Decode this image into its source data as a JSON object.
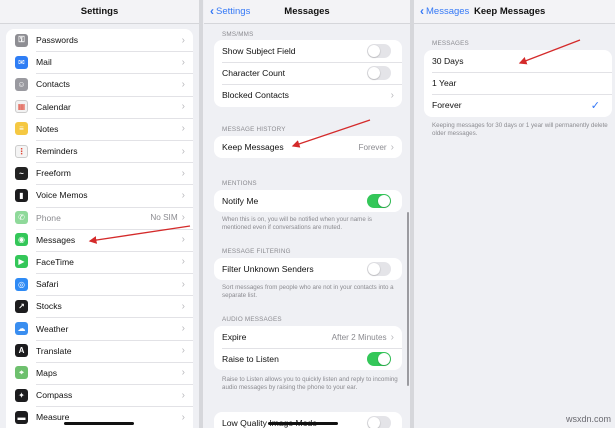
{
  "settings_pane": {
    "title": "Settings",
    "items": [
      {
        "label": "Passwords",
        "icon": "key-icon",
        "color": "#8e8e93",
        "glyph": "⚿"
      },
      {
        "label": "Mail",
        "icon": "mail-icon",
        "color": "#2f7ef5",
        "glyph": "✉"
      },
      {
        "label": "Contacts",
        "icon": "contacts-icon",
        "color": "#9a9aa0",
        "glyph": "☺"
      },
      {
        "label": "Calendar",
        "icon": "calendar-icon",
        "color": "#f2f2f2",
        "glyph": "▦"
      },
      {
        "label": "Notes",
        "icon": "notes-icon",
        "color": "#f5c842",
        "glyph": "≡"
      },
      {
        "label": "Reminders",
        "icon": "reminders-icon",
        "color": "#f4f4f4",
        "glyph": "⋮"
      },
      {
        "label": "Freeform",
        "icon": "freeform-icon",
        "color": "#222222",
        "glyph": "~"
      },
      {
        "label": "Voice Memos",
        "icon": "voice-memos-icon",
        "color": "#1c1c1e",
        "glyph": "▮"
      },
      {
        "label": "Phone",
        "icon": "phone-icon",
        "color": "#8fd99a",
        "glyph": "✆",
        "value": "No SIM",
        "dimmed": true
      },
      {
        "label": "Messages",
        "icon": "messages-icon",
        "color": "#34c759",
        "glyph": "◉"
      },
      {
        "label": "FaceTime",
        "icon": "facetime-icon",
        "color": "#34c759",
        "glyph": "▶"
      },
      {
        "label": "Safari",
        "icon": "safari-icon",
        "color": "#2f8bf5",
        "glyph": "◎"
      },
      {
        "label": "Stocks",
        "icon": "stocks-icon",
        "color": "#1c1c1e",
        "glyph": "↗"
      },
      {
        "label": "Weather",
        "icon": "weather-icon",
        "color": "#3a8ef0",
        "glyph": "☁"
      },
      {
        "label": "Translate",
        "icon": "translate-icon",
        "color": "#1c1c1e",
        "glyph": "A"
      },
      {
        "label": "Maps",
        "icon": "maps-icon",
        "color": "#6ec06e",
        "glyph": "⌖"
      },
      {
        "label": "Compass",
        "icon": "compass-icon",
        "color": "#1c1c1e",
        "glyph": "✦"
      },
      {
        "label": "Measure",
        "icon": "measure-icon",
        "color": "#1c1c1e",
        "glyph": "▬"
      }
    ]
  },
  "messages_pane": {
    "back_label": "Settings",
    "title": "Messages",
    "sms_header": "SMS/MMS",
    "show_subject": "Show Subject Field",
    "character_count": "Character Count",
    "blocked_contacts": "Blocked Contacts",
    "history_header": "MESSAGE HISTORY",
    "keep_messages": "Keep Messages",
    "keep_messages_value": "Forever",
    "mentions_header": "MENTIONS",
    "notify_me": "Notify Me",
    "notify_footnote": "When this is on, you will be notified when your name is mentioned even if conversations are muted.",
    "filtering_header": "MESSAGE FILTERING",
    "filter_unknown": "Filter Unknown Senders",
    "filter_footnote": "Sort messages from people who are not in your contacts into a separate list.",
    "audio_header": "AUDIO MESSAGES",
    "expire": "Expire",
    "expire_value": "After 2 Minutes",
    "raise_to_listen": "Raise to Listen",
    "raise_footnote": "Raise to Listen allows you to quickly listen and reply to incoming audio messages by raising the phone to your ear.",
    "low_quality": "Low Quality Image Mode",
    "toggles": {
      "show_subject": false,
      "character_count": false,
      "notify_me": true,
      "filter_unknown": false,
      "raise_to_listen": true,
      "low_quality": false
    }
  },
  "keep_pane": {
    "back_label": "Messages",
    "title": "Keep Messages",
    "section_header": "MESSAGES",
    "options": [
      "30 Days",
      "1 Year",
      "Forever"
    ],
    "selected": "Forever",
    "footnote": "Keeping messages for 30 days or 1 year will permanently delete older messages."
  },
  "watermark": "wsxdn.com",
  "colors": {
    "accent": "#3478f6",
    "toggle_on": "#34c759",
    "annotation_arrow": "#d42a2a"
  }
}
